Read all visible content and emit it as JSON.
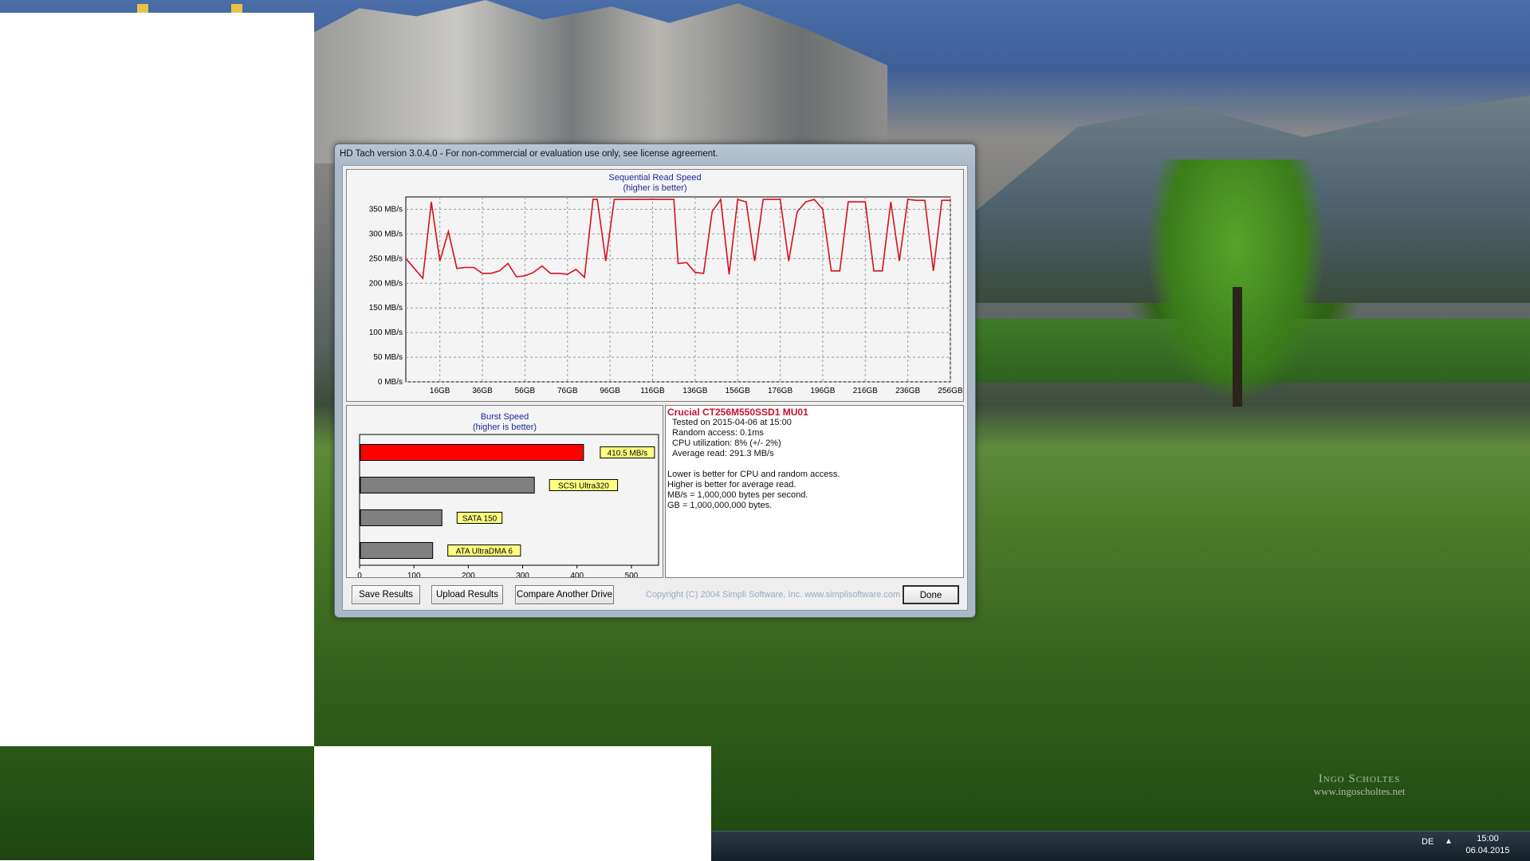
{
  "window": {
    "title": "HD Tach version 3.0.4.0  - For non-commercial or evaluation use only, see license agreement."
  },
  "sequential": {
    "title": "Sequential Read Speed",
    "subtitle": "(higher is better)"
  },
  "burst": {
    "title": "Burst Speed",
    "subtitle": "(higher is better)"
  },
  "info": {
    "drive": "Crucial CT256M550SSD1 MU01",
    "tested": "Tested on 2015-04-06 at 15:00",
    "random_access": "Random access: 0.1ms",
    "cpu": "CPU utilization: 8% (+/- 2%)",
    "average_read": "Average read: 291.3 MB/s",
    "note1": "Lower is better for CPU and random access.",
    "note2": "Higher is better for average read.",
    "note3": "MB/s = 1,000,000 bytes per second.",
    "note4": "GB = 1,000,000,000 bytes."
  },
  "buttons": {
    "save": "Save Results",
    "upload": "Upload Results",
    "compare": "Compare Another Drive",
    "done": "Done"
  },
  "copyright": "Copyright (C) 2004 Simpli Software, Inc. www.simplisoftware.com",
  "taskbar": {
    "language": "DE",
    "tray_arrow": "▲",
    "time": "15:00",
    "date": "06.04.2015"
  },
  "watermark": {
    "line1": "Ingo Scholtes",
    "line2": "www.ingoscholtes.net"
  },
  "colors": {
    "line": "#d7101c",
    "burst_bar": "#ff0000",
    "reference_bar": "#808080",
    "label_bg": "#ffff80",
    "chart_title": "#1e2a9c"
  },
  "chart_data": [
    {
      "type": "line",
      "title": "Sequential Read Speed",
      "subtitle": "(higher is better)",
      "ylim": [
        0,
        375
      ],
      "y_ticks": [
        0,
        50,
        100,
        150,
        200,
        250,
        300,
        350
      ],
      "y_tick_labels": [
        "0 MB/s",
        "50 MB/s",
        "100 MB/s",
        "150 MB/s",
        "200 MB/s",
        "250 MB/s",
        "300 MB/s",
        "350 MB/s"
      ],
      "xlim": [
        0,
        256
      ],
      "x_ticks": [
        16,
        36,
        56,
        76,
        96,
        116,
        136,
        156,
        176,
        196,
        216,
        236,
        256
      ],
      "x_tick_labels": [
        "16GB",
        "36GB",
        "56GB",
        "76GB",
        "96GB",
        "116GB",
        "136GB",
        "156GB",
        "176GB",
        "196GB",
        "216GB",
        "236GB",
        "256GB"
      ],
      "grid": true,
      "series": [
        {
          "x": [
            0,
            4,
            8,
            12,
            16,
            20,
            24,
            28,
            32,
            36,
            40,
            44,
            48,
            52,
            56,
            60,
            64,
            68,
            72,
            76,
            80,
            84,
            88,
            90,
            94,
            98,
            102,
            106,
            110,
            114,
            118,
            122,
            126,
            128,
            132,
            136,
            140,
            144,
            148,
            152,
            156,
            160,
            164,
            168,
            172,
            176,
            180,
            184,
            188,
            192,
            196,
            200,
            204,
            208,
            212,
            216,
            220,
            224,
            228,
            232,
            236,
            240,
            244,
            248,
            252,
            256
          ],
          "y": [
            250,
            230,
            210,
            365,
            245,
            305,
            230,
            232,
            232,
            220,
            220,
            225,
            240,
            213,
            215,
            222,
            235,
            220,
            220,
            218,
            228,
            212,
            370,
            370,
            245,
            370,
            370,
            370,
            370,
            370,
            370,
            370,
            370,
            240,
            242,
            222,
            220,
            345,
            370,
            218,
            370,
            365,
            245,
            370,
            370,
            370,
            245,
            345,
            365,
            370,
            350,
            225,
            225,
            365,
            365,
            365,
            225,
            225,
            365,
            245,
            370,
            368,
            368,
            225,
            368,
            368
          ]
        }
      ]
    },
    {
      "type": "bar",
      "orientation": "horizontal",
      "title": "Burst Speed",
      "subtitle": "(higher is better)",
      "xlim": [
        0,
        550
      ],
      "x_ticks": [
        0,
        100,
        200,
        300,
        400,
        500
      ],
      "x_tick_labels": [
        "0",
        "100",
        "200",
        "300",
        "400",
        "500"
      ],
      "categories": [
        "410.5 MB/s",
        "SCSI Ultra320",
        "SATA 150",
        "ATA UltraDMA 6"
      ],
      "values": [
        410.5,
        320,
        150,
        133
      ]
    }
  ]
}
